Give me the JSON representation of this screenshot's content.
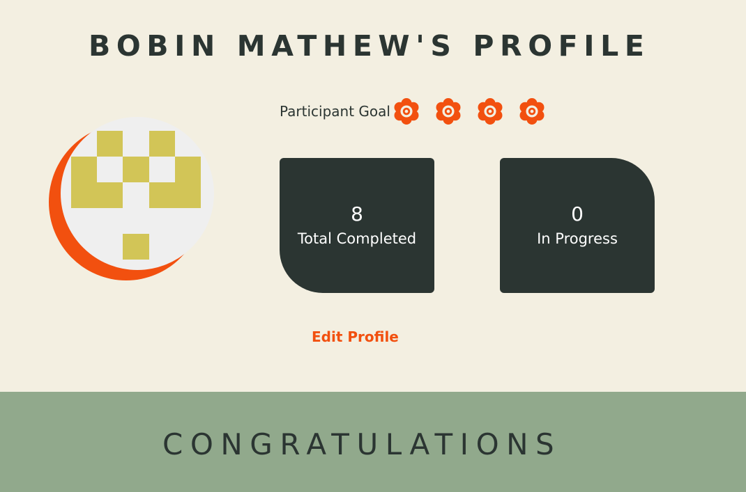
{
  "profile": {
    "title": "BOBIN MATHEW'S PROFILE",
    "goal_label": "Participant Goal",
    "goal_icons": [
      "badge-icon",
      "badge-icon",
      "badge-icon",
      "badge-icon"
    ],
    "edit_label": "Edit Profile"
  },
  "stats": {
    "completed_value": "8",
    "completed_label": "Total Completed",
    "progress_value": "0",
    "progress_label": "In Progress"
  },
  "banner": {
    "text": "CONGRATULATIONS"
  },
  "colors": {
    "background": "#f3efe1",
    "dark": "#2b3532",
    "accent": "#f2500f",
    "banner": "#91a98c",
    "avatar_pattern": "#d2c557",
    "avatar_bg": "#efefef"
  }
}
